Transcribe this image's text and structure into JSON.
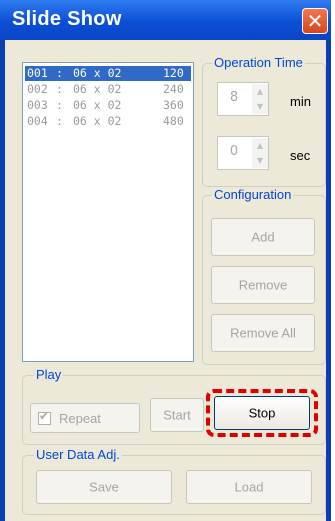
{
  "window": {
    "title": "Slide Show",
    "close_glyph": "✕"
  },
  "slides": [
    {
      "id": "001",
      "sep": ":",
      "size": "06 x 02",
      "time": "120",
      "selected": true
    },
    {
      "id": "002",
      "sep": ":",
      "size": "06 x 02",
      "time": "240",
      "selected": false
    },
    {
      "id": "003",
      "sep": ":",
      "size": "06 x 02",
      "time": "360",
      "selected": false
    },
    {
      "id": "004",
      "sep": ":",
      "size": "06 x 02",
      "time": "480",
      "selected": false
    }
  ],
  "operation_time": {
    "label": "Operation Time",
    "minutes": {
      "value": "8",
      "unit": "min"
    },
    "seconds": {
      "value": "0",
      "unit": "sec"
    }
  },
  "configuration": {
    "label": "Configuration",
    "add": "Add",
    "remove": "Remove",
    "remove_all": "Remove All"
  },
  "play": {
    "label": "Play",
    "repeat_label": "Repeat",
    "repeat_checked": true,
    "start": "Start",
    "stop": "Stop"
  },
  "user_data": {
    "label": "User Data Adj.",
    "save": "Save",
    "load": "Load"
  },
  "colors": {
    "title_bar": "#0b4fd6",
    "selection": "#3169c6",
    "focus_highlight": "#e00000",
    "group_label": "#0046d5"
  }
}
